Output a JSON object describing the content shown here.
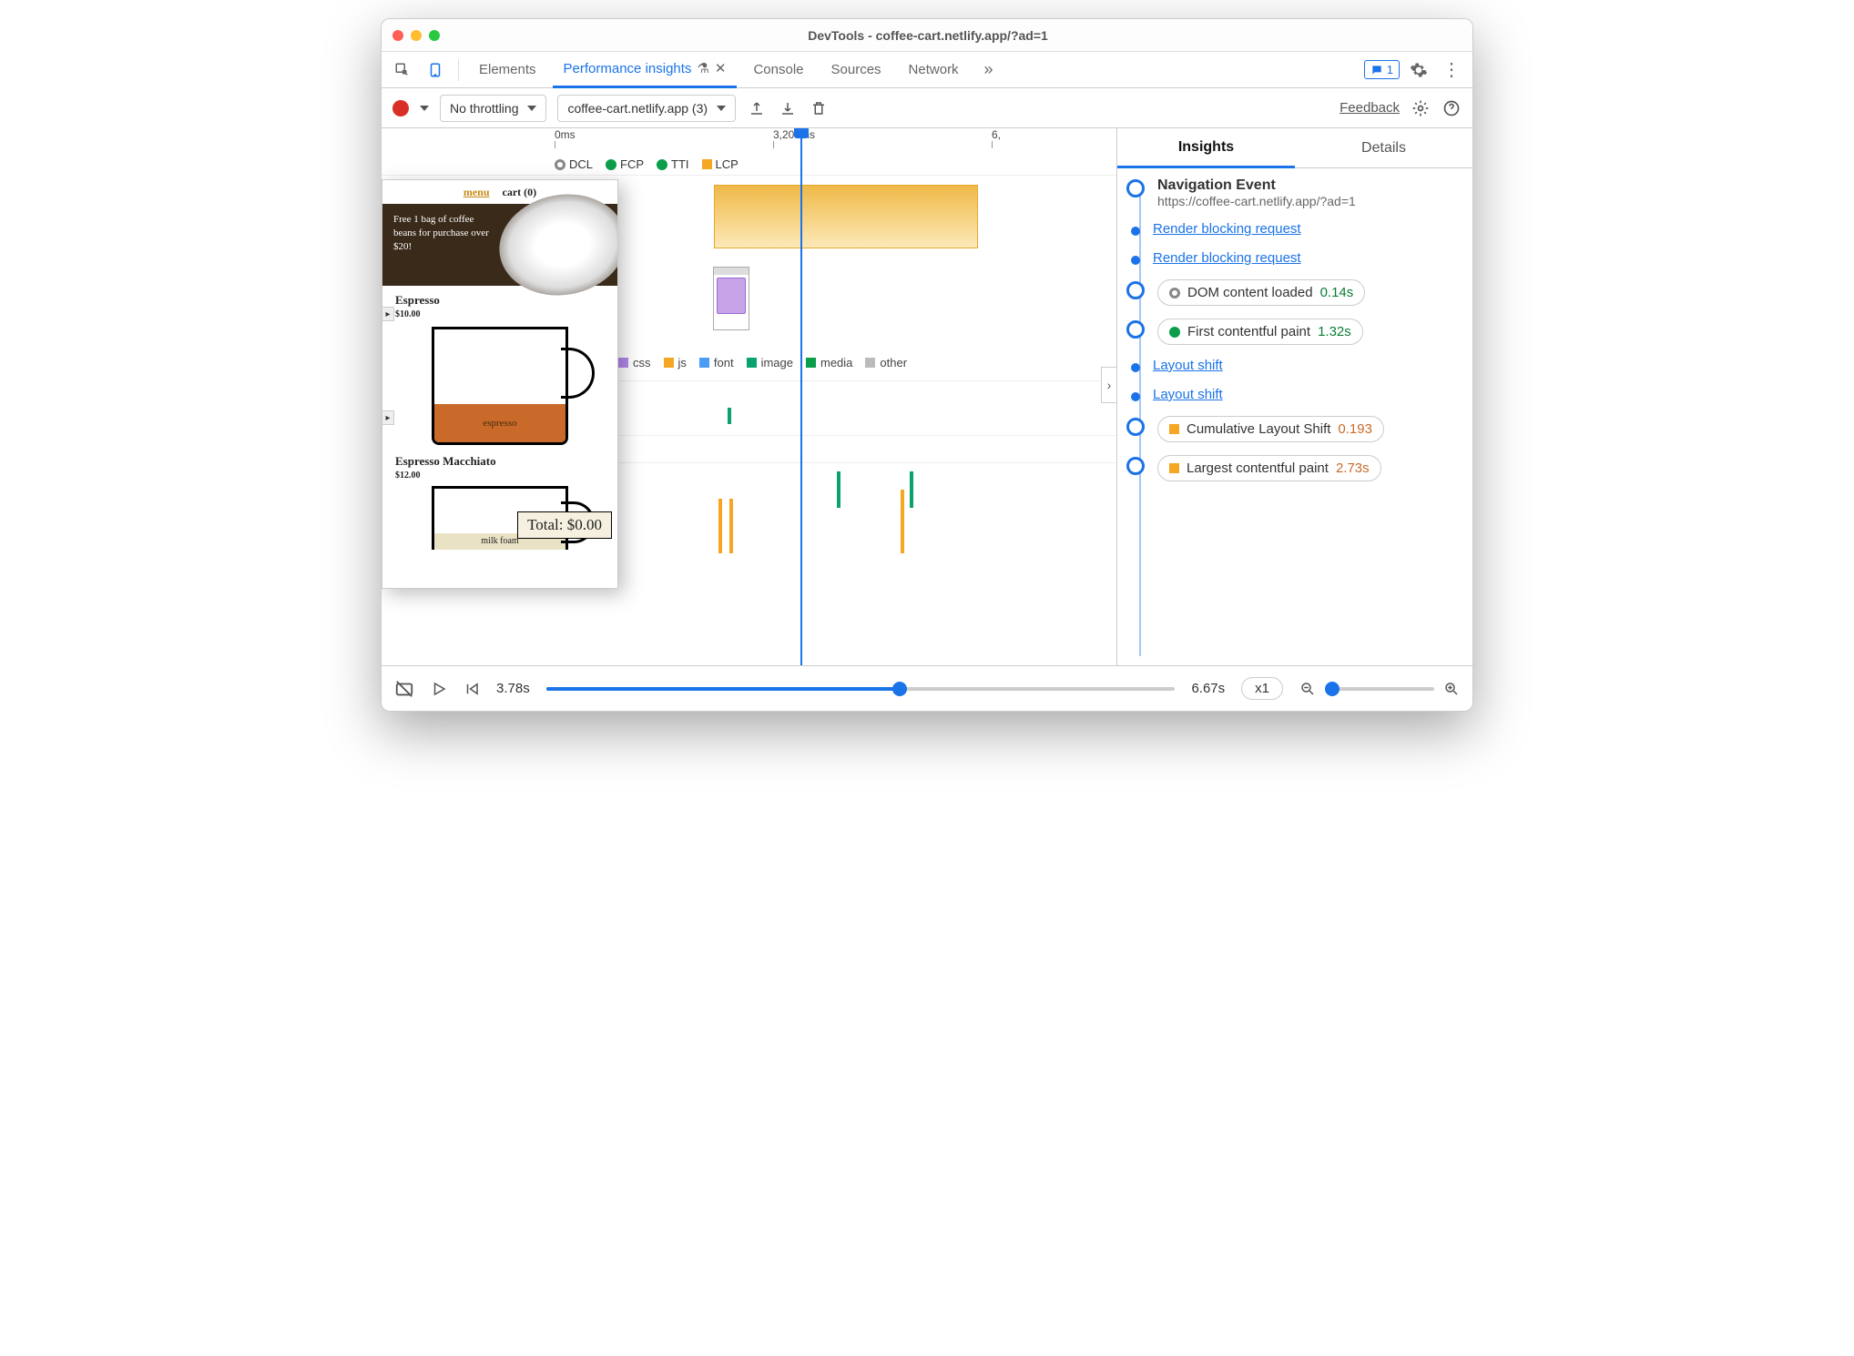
{
  "window_title": "DevTools - coffee-cart.netlify.app/?ad=1",
  "tabs": {
    "elements": "Elements",
    "performance": "Performance insights",
    "console": "Console",
    "sources": "Sources",
    "network": "Network"
  },
  "issues_count": "1",
  "toolbar": {
    "throttle": "No throttling",
    "page_select": "coffee-cart.netlify.app (3)",
    "feedback": "Feedback"
  },
  "timeline": {
    "tick0": "0ms",
    "tick1": "3,200ms",
    "tick2": "6,",
    "markers": {
      "dcl": "DCL",
      "fcp": "FCP",
      "tti": "TTI",
      "lcp": "LCP"
    },
    "legend": {
      "css": "css",
      "js": "js",
      "font": "font",
      "image": "image",
      "media": "media",
      "other": "other"
    }
  },
  "preview": {
    "menu": "menu",
    "cart": "cart (0)",
    "hero": "Free 1 bag of coffee beans for purchase over $20!",
    "item1": "Espresso",
    "price1": "$10.00",
    "fill1": "espresso",
    "item2": "Espresso Macchiato",
    "price2": "$12.00",
    "foam": "milk foam",
    "total": "Total: $0.00"
  },
  "right": {
    "tab_insights": "Insights",
    "tab_details": "Details",
    "nav_title": "Navigation Event",
    "nav_url": "https://coffee-cart.netlify.app/?ad=1",
    "rbr": "Render blocking request",
    "dcl_label": "DOM content loaded",
    "dcl_val": "0.14s",
    "fcp_label": "First contentful paint",
    "fcp_val": "1.32s",
    "ls": "Layout shift",
    "cls_label": "Cumulative Layout Shift",
    "cls_val": "0.193",
    "lcp_label": "Largest contentful paint",
    "lcp_val": "2.73s"
  },
  "footer": {
    "time": "3.78s",
    "end": "6.67s",
    "zoom_mult": "x1"
  },
  "colors": {
    "green": "#0a9d4a",
    "orange": "#f5a623",
    "purple": "#b388eb",
    "blue": "#4b9cf5",
    "gray": "#bbb",
    "teal": "#0aa36f"
  }
}
